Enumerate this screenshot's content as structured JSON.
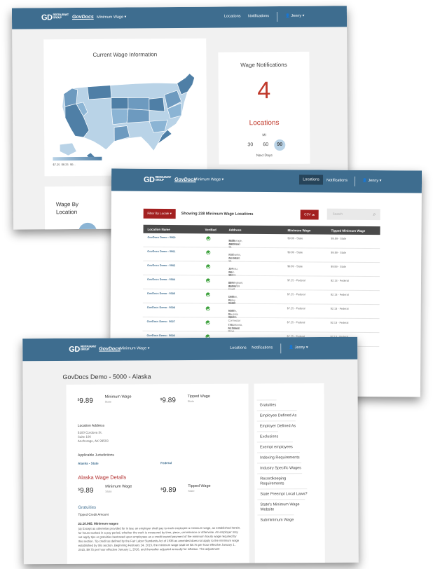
{
  "nav": {
    "logo_text": "GD",
    "logo_sub": "RESTAURANT GROUP",
    "brand": "GovDocs",
    "menu": "Minimum Wage",
    "locations": "Locations",
    "notifications": "Notifications",
    "user": "Jenny"
  },
  "screen1": {
    "map_title": "Current Wage Information",
    "legend": [
      "$7.25",
      "$8.25",
      "$9..."
    ],
    "bottom_title_1": "Wage By",
    "bottom_title_2": "Location",
    "notif_title": "Wage Notifications",
    "notif_count": "4",
    "notif_label": "Locations",
    "day_options": [
      "30",
      "60",
      "90"
    ],
    "day_selected": "90",
    "days_caption": "Next Days",
    "mi_label": "MI"
  },
  "screen2": {
    "filter_label": "Filter By Locale",
    "showing": "Showing 238 Minimum Wage Locations",
    "csv_label": "CSV",
    "search_placeholder": "Search",
    "columns": [
      "Location Name",
      "Verified",
      "Address",
      "Minimum Wage",
      "Tipped Minimum Wage"
    ],
    "rows": [
      {
        "name": "GovDocs Demo - 5000",
        "address": [
          "5100 Cordova St.",
          "Suite 100",
          "Anchorage, AK 99503"
        ],
        "min": "$9.89 - State",
        "tipped": "$9.89 - State"
      },
      {
        "name": "GovDocs Demo - 5001",
        "address": [
          "225 Bernelar St.",
          "Fairbanks, AK 99701"
        ],
        "min": "$9.89 - State",
        "tipped": "$9.89 - State"
      },
      {
        "name": "GovDocs Demo - 5002",
        "address": [
          "124 Main St.",
          "Juneau, AK 99801"
        ],
        "min": "$9.89 - State",
        "tipped": "$9.89 - State"
      },
      {
        "name": "GovDocs Demo - 5004",
        "address": [
          "22 Barber Court",
          "Suite 113",
          "Birmingham, AL 35209"
        ],
        "min": "$7.25 - Federal",
        "tipped": "$2.13 - Federal"
      },
      {
        "name": "GovDocs Demo - 5005",
        "address": [
          "1800 Finley Road",
          "Dothan, AL 36303"
        ],
        "min": "$7.25 - Federal",
        "tipped": "$2.13 - Federal"
      },
      {
        "name": "GovDocs Demo - 5006",
        "address": [
          "3200 Dauphin Square Connector",
          "Mobile, AL 36607"
        ],
        "min": "$7.25 - Federal",
        "tipped": "$2.13 - Federal"
      },
      {
        "name": "GovDocs Demo - 5007",
        "address": [
          "1711 Mcfarland Drive",
          "Tuscaloosa, AL 35401"
        ],
        "min": "$7.25 - Federal",
        "tipped": "$2.13 - Federal"
      },
      {
        "name": "GovDocs Demo - 5008",
        "address": [
          "151 Stage Road"
        ],
        "min": "$7.25 - Federal",
        "tipped": "$2.13 - Federal"
      }
    ]
  },
  "screen3": {
    "page_title": "GovDocs Demo - 5000 - Alaska",
    "currency": "$",
    "min_wage": "9.89",
    "min_label": "Minimum Wage",
    "min_sub": "State",
    "tipped_wage": "9.89",
    "tipped_label": "Tipped Wage",
    "tipped_sub": "State",
    "address_heading": "Location Address",
    "address": [
      "5100 Cordova St.",
      "Suite 100",
      "Anchorage, AK 99503"
    ],
    "juris_heading": "Applicable Jurisdictions",
    "juris_1": "Alaska - State",
    "juris_2": "Federal",
    "details_heading": "Alaska Wage Details",
    "gratuities": "Gratuities",
    "tipped_credit": "Tipped Credit Amount",
    "statute_heading": "23.10.065. Minimum wages",
    "statute_text": "(a) Except as otherwise provided for in law, an employer shall pay to each employee a minimum wage, as established herein, for hours worked in a pay period, whether the work is measured by time, piece, commission or otherwise. An employer may not apply tips or gratuities bestowed upon employees as a credit toward payment of the minimum hourly wage required by this section. Tip credit as defined by the Fair Labor Standards Act of 1938 as amended does not apply to the minimum wage established by this section. Beginning February 24, 2015, the minimum wage shall be $8.75 per hour effective January 1, 2015, $9.75 per hour effective January 1, 2016, and thereafter adjusted annually for inflation. The adjustment",
    "sidebar": [
      "Gratuities",
      "Employee Defined As",
      "Employer Defined As",
      "Exclusions",
      "Exempt employees",
      "Indexing Requirements",
      "Industry Specific Wages",
      "Recordkeeping Requirements",
      "State Preempt Local Laws?",
      "State's Minimum Wage Website",
      "Subminimum Wage"
    ]
  },
  "colors": {
    "nav": "#3e6d8f",
    "accent_red": "#c0392b",
    "map_dark": "#4f7fa6",
    "map_light": "#b9d3e7"
  }
}
